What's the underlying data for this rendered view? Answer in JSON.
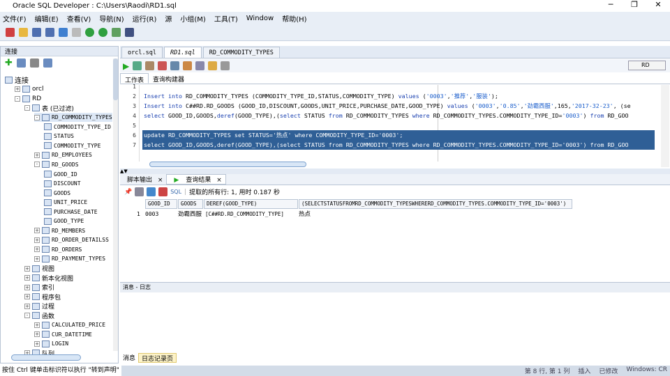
{
  "window": {
    "title": "Oracle SQL Developer : C:\\Users\\Raodi\\RD1.sql",
    "min": "─",
    "max": "❐",
    "close": "✕"
  },
  "menu": [
    "文件(F)",
    "编辑(E)",
    "查看(V)",
    "导航(N)",
    "运行(R)",
    "源",
    "小组(M)",
    "工具(T)",
    "Window",
    "帮助(H)"
  ],
  "left": {
    "header": "连接",
    "tree": [
      {
        "t": "连接",
        "lvl": 0,
        "exp": ""
      },
      {
        "t": "orcl",
        "lvl": 1,
        "exp": "+"
      },
      {
        "t": "RD",
        "lvl": 1,
        "exp": "-"
      },
      {
        "t": "表 (已过滤)",
        "lvl": 2,
        "exp": "-"
      },
      {
        "t": "RD_COMMODITY_TYPES",
        "lvl": 3,
        "exp": "-",
        "mono": true,
        "sel": true
      },
      {
        "t": "COMMODITY_TYPE_ID",
        "lvl": 4,
        "exp": "",
        "mono": true
      },
      {
        "t": "STATUS",
        "lvl": 4,
        "exp": "",
        "mono": true
      },
      {
        "t": "COMMODITY_TYPE",
        "lvl": 4,
        "exp": "",
        "mono": true
      },
      {
        "t": "RD_EMPLOYEES",
        "lvl": 3,
        "exp": "+",
        "mono": true
      },
      {
        "t": "RD_GOODS",
        "lvl": 3,
        "exp": "-",
        "mono": true
      },
      {
        "t": "GOOD_ID",
        "lvl": 4,
        "exp": "",
        "mono": true
      },
      {
        "t": "DISCOUNT",
        "lvl": 4,
        "exp": "",
        "mono": true
      },
      {
        "t": "GOODS",
        "lvl": 4,
        "exp": "",
        "mono": true
      },
      {
        "t": "UNIT_PRICE",
        "lvl": 4,
        "exp": "",
        "mono": true
      },
      {
        "t": "PURCHASE_DATE",
        "lvl": 4,
        "exp": "",
        "mono": true
      },
      {
        "t": "GOOD_TYPE",
        "lvl": 4,
        "exp": "",
        "mono": true
      },
      {
        "t": "RD_MEMBERS",
        "lvl": 3,
        "exp": "+",
        "mono": true
      },
      {
        "t": "RD_ORDER_DETAILSS",
        "lvl": 3,
        "exp": "+",
        "mono": true
      },
      {
        "t": "RD_ORDERS",
        "lvl": 3,
        "exp": "+",
        "mono": true
      },
      {
        "t": "RD_PAYMENT_TYPES",
        "lvl": 3,
        "exp": "+",
        "mono": true
      },
      {
        "t": "视图",
        "lvl": 2,
        "exp": "+"
      },
      {
        "t": "新本化视图",
        "lvl": 2,
        "exp": "+"
      },
      {
        "t": "索引",
        "lvl": 2,
        "exp": "+"
      },
      {
        "t": "程序包",
        "lvl": 2,
        "exp": "+"
      },
      {
        "t": "过程",
        "lvl": 2,
        "exp": "+"
      },
      {
        "t": "函数",
        "lvl": 2,
        "exp": "-"
      },
      {
        "t": "CALCULATED_PRICE",
        "lvl": 3,
        "exp": "+",
        "mono": true
      },
      {
        "t": "CUR_DATETIME",
        "lvl": 3,
        "exp": "+",
        "mono": true
      },
      {
        "t": "LOGIN",
        "lvl": 3,
        "exp": "+",
        "mono": true
      },
      {
        "t": "队列",
        "lvl": 2,
        "exp": "+"
      }
    ]
  },
  "editor": {
    "tabs": [
      "orcl.sql",
      "RD1.sql",
      "RD_COMMODITY_TYPES"
    ],
    "connection": "RD",
    "subtabs": [
      "工作表",
      "查询构建器"
    ],
    "lines": [
      {
        "n": "1",
        "text": ""
      },
      {
        "n": "2",
        "text": "Insert into RD_COMMODITY_TYPES (COMMODITY_TYPE_ID,STATUS,COMMODITY_TYPE) values ('0003','推荐','服装');"
      },
      {
        "n": "3",
        "text": "Insert into C##RD.RD_GOODS (GOOD_ID,DISCOUNT,GOODS,UNIT_PRICE,PURCHASE_DATE,GOOD_TYPE) values ('0003','0.85','劲霸西服',165,'2017-32-23', (se"
      },
      {
        "n": "4",
        "text": "select GOOD_ID,GOODS,deref(GOOD_TYPE),(select STATUS from RD_COMMODITY_TYPES where RD_COMMODITY_TYPES.COMMODITY_TYPE_ID='0003') from RD_GOO"
      },
      {
        "n": "5",
        "text": ""
      },
      {
        "n": "6",
        "text": "update RD_COMMODITY_TYPES set STATUS='热点' where COMMODITY_TYPE_ID='0003';",
        "sel": true
      },
      {
        "n": "7",
        "text": "select GOOD_ID,GOODS,deref(GOOD_TYPE),(select STATUS from RD_COMMODITY_TYPES where RD_COMMODITY_TYPES.COMMODITY_TYPE_ID='0003') from RD_GOO",
        "sel": true
      }
    ]
  },
  "results": {
    "tabs": [
      "脚本输出",
      "查询结果"
    ],
    "sql_label": "SQL",
    "status": "提取的所有行: 1, 用时 0.187 秒",
    "columns": [
      "GOOD_ID",
      "GOODS",
      "DEREF(GOOD_TYPE)",
      "(SELECTSTATUSFROMRD_COMMODITY_TYPESWHERERD_COMMODITY_TYPES.COMMODITY_TYPE_ID='0003')"
    ],
    "rows": [
      {
        "num": "1",
        "cells": [
          "0003",
          "劲霸西服",
          "[C##RD.RD_COMMODITY_TYPE]",
          "热点"
        ]
      }
    ]
  },
  "log": {
    "header": "消息 - 日志",
    "tabs": [
      "消息",
      "日志记录页"
    ]
  },
  "statusbar": {
    "hint": "按住 Ctrl 键单击标识符以执行 \"转到声明\"",
    "pos": "第 8 行, 第 1 列",
    "mode": "插入",
    "modified": "已修改",
    "eol": "Windows: CR"
  }
}
